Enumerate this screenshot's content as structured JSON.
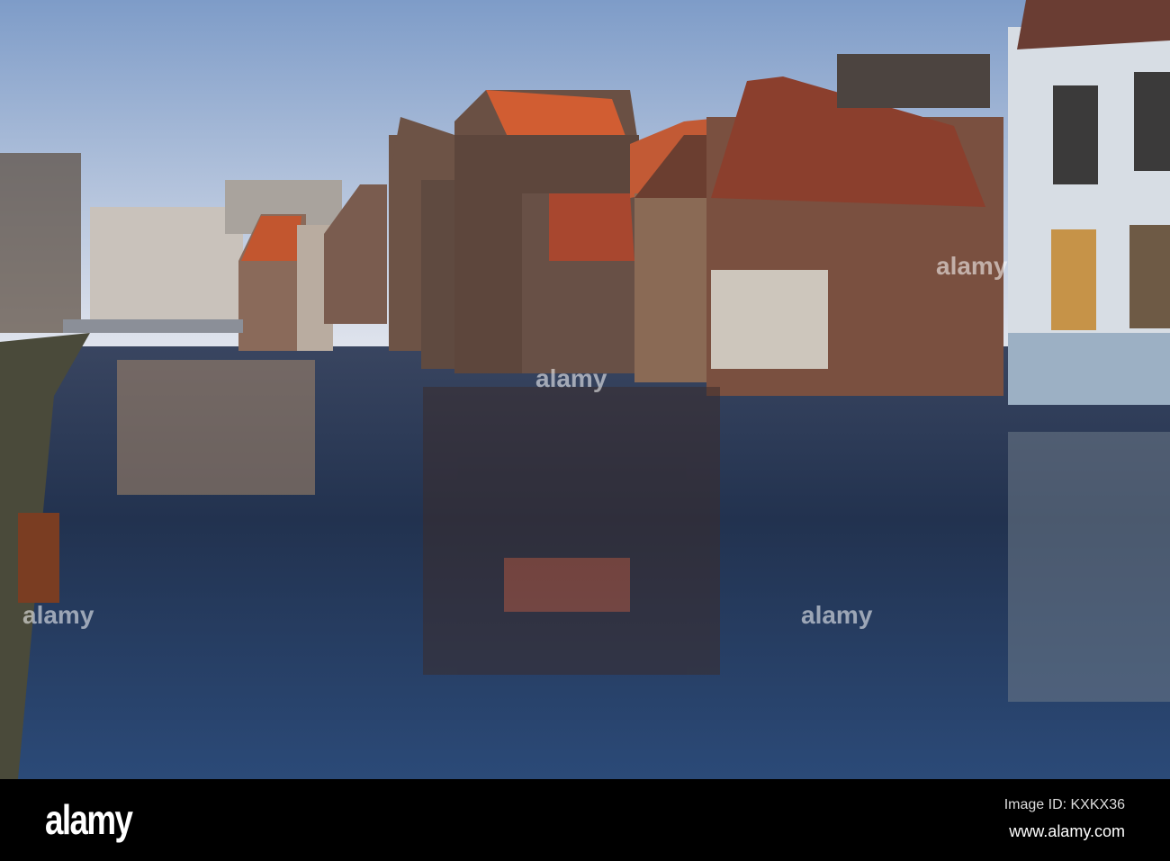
{
  "watermark": {
    "brand": "alamy",
    "image_id": "Image ID: KXKX36",
    "site": "www.alamy.com"
  },
  "colors": {
    "sky_top": "#7e9cc8",
    "sky_bottom": "#dfe4ee",
    "water": "#1c2c4a",
    "brick": "#6b4c40",
    "roof": "#c45a35"
  }
}
